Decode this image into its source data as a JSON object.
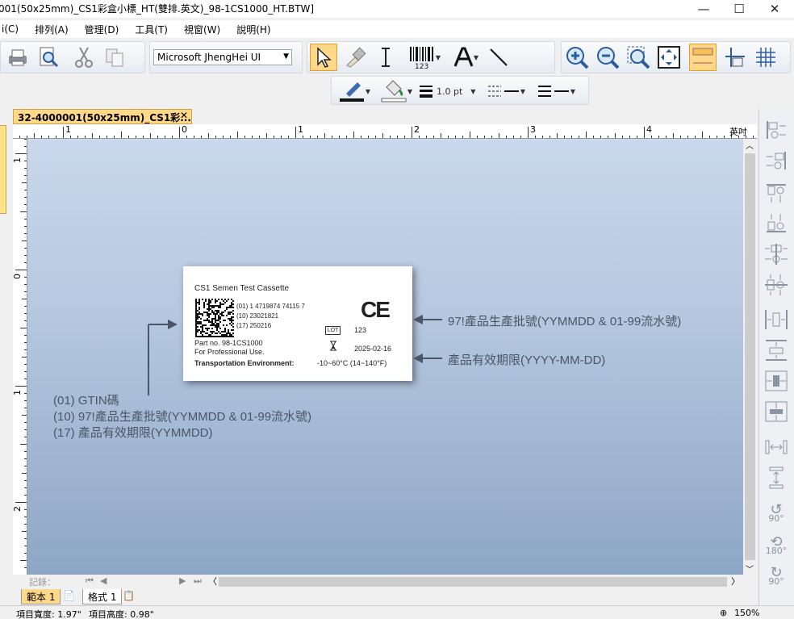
{
  "window": {
    "title": "001(50x25mm)_CS1彩盒小標_HT(雙排.英文)_98-1CS1000_HT.BTW]",
    "minimize": "—",
    "maximize": "☐",
    "close": "✕"
  },
  "menu": [
    "i(C)",
    "排列(A)",
    "管理(D)",
    "工具(T)",
    "視窗(W)",
    "說明(H)"
  ],
  "toolbar": {
    "font_name": "Microsoft JhengHei UI",
    "line_width": "1.0 pt",
    "barcode_caption": "123"
  },
  "tab": {
    "label": "32-4000001(50x25mm)_CS1彩...",
    "close": "✕"
  },
  "ruler": {
    "unit": "英吋",
    "h_labels": [
      "1",
      "0",
      "1",
      "2",
      "3",
      "4"
    ],
    "v_labels": [
      "1",
      "0",
      "1",
      "2"
    ]
  },
  "label": {
    "title": "CS1 Semen Test Cassette",
    "gs1_lines": [
      "(01) 1 4719874 74115 7",
      "(10) 23021821",
      "(17) 250216"
    ],
    "ce_mark": "CE",
    "lot_symbol": "LOT",
    "lot_value": "123",
    "expiry_value": "2025-02-16",
    "part_no": "Part no. 98-1CS1000",
    "professional": "For Professional Use.",
    "transport_label": "Transportation Environment:",
    "transport_value": "-10~60°C (14~140°F)"
  },
  "annotations": {
    "lot_note": "97!產品生產批號(YYMMDD & 01-99流水號)",
    "expiry_note": "產品有效期限(YYYY-MM-DD)",
    "gtin_lines": [
      "(01) GTIN碼",
      "(10) 97!產品生產批號(YYMMDD & 01-99流水號)",
      "(17) 產品有效期限(YYMMDD)"
    ]
  },
  "record_nav": {
    "label": "記錄："
  },
  "sheets": [
    "範本 1",
    "格式 1"
  ],
  "right_panel": {
    "rotate_labels": [
      "90°",
      "180°",
      "90°"
    ]
  },
  "status": {
    "width": "項目寬度: 1.97\"",
    "height": "項目高度: 0.98\"",
    "zoom": "150%"
  }
}
